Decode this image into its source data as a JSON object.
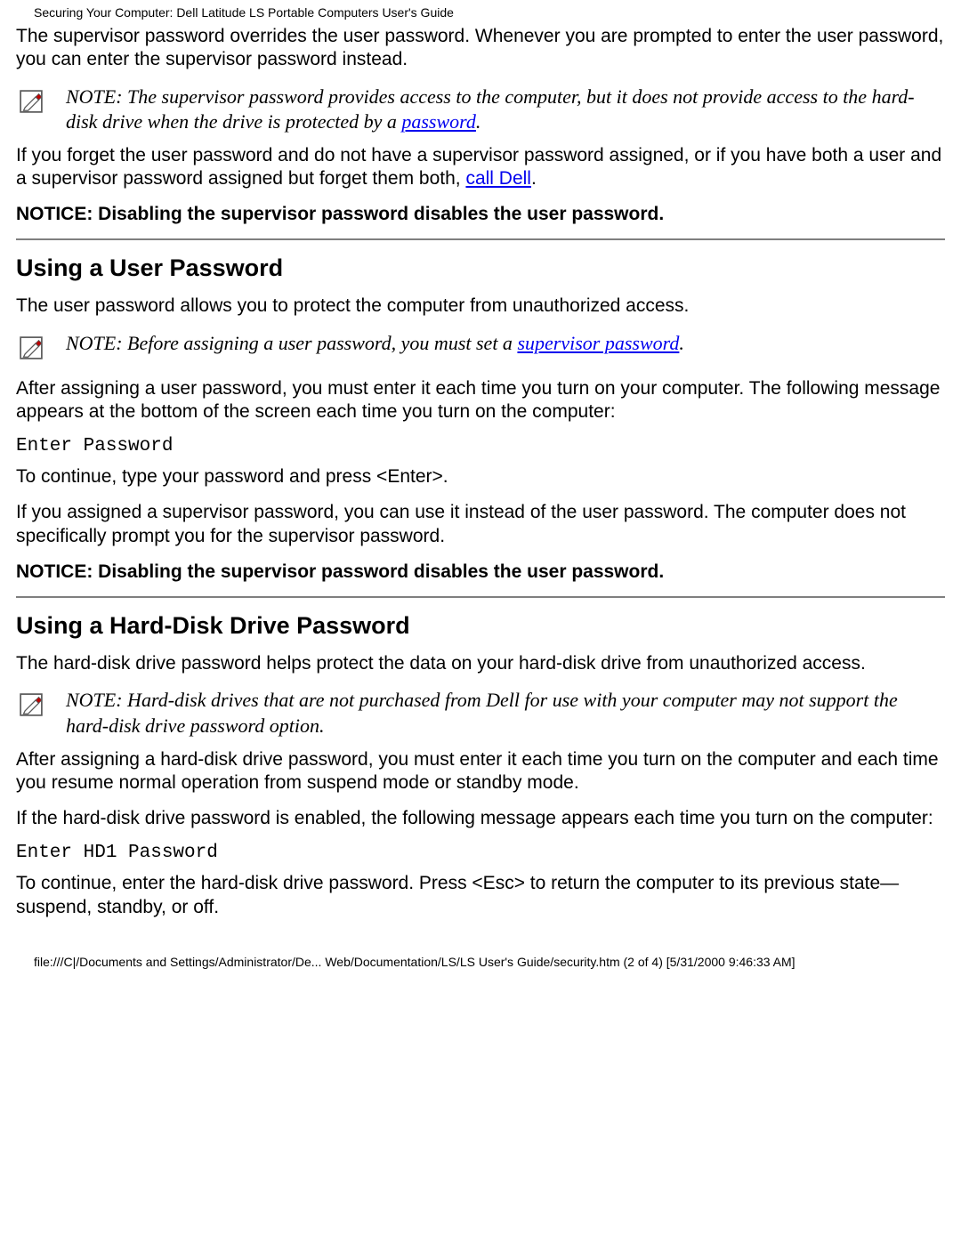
{
  "header_title": "Securing Your Computer: Dell Latitude LS Portable Computers User's Guide",
  "intro_paragraph": "The supervisor password overrides the user password. Whenever you are prompted to enter the user password, you can enter the supervisor password instead.",
  "note1": {
    "prefix": "NOTE: The supervisor password provides access to the computer, but it does not provide access to the hard-disk drive when the drive is protected by a ",
    "link": "password",
    "suffix": "."
  },
  "forgot_paragraph": {
    "prefix": "If you forget the user password and do not have a supervisor password assigned, or if you have both a user and a supervisor password assigned but forget them both, ",
    "link": "call Dell",
    "suffix": "."
  },
  "notice1": "NOTICE: Disabling the supervisor password disables the user password.",
  "section_user": {
    "heading": "Using a User Password",
    "p1": "The user password allows you to protect the computer from unauthorized access.",
    "note": {
      "prefix": "NOTE: Before assigning a user password, you must set a ",
      "link": "supervisor password",
      "suffix": "."
    },
    "p2": "After assigning a user password, you must enter it each time you turn on your computer. The following message appears at the bottom of the screen each time you turn on the computer:",
    "code": "Enter Password",
    "p3": "To continue, type your password and press <Enter>.",
    "p4": "If you assigned a supervisor password, you can use it instead of the user password. The computer does not specifically prompt you for the supervisor password.",
    "notice": "NOTICE: Disabling the supervisor password disables the user password."
  },
  "section_hdd": {
    "heading": "Using a Hard-Disk Drive Password",
    "p1": "The hard-disk drive password helps protect the data on your hard-disk drive from unauthorized access.",
    "note": "NOTE: Hard-disk drives that are not purchased from Dell for use with your computer may not support the hard-disk drive password option.",
    "p2": "After assigning a hard-disk drive password, you must enter it each time you turn on the computer and each time you resume normal operation from suspend mode or standby mode.",
    "p3": "If the hard-disk drive password is enabled, the following message appears each time you turn on the computer:",
    "code": "Enter HD1 Password",
    "p4": "To continue, enter the hard-disk drive password. Press <Esc> to return the computer to its previous state—suspend, standby, or off."
  },
  "footer": "file:///C|/Documents and Settings/Administrator/De... Web/Documentation/LS/LS User's Guide/security.htm (2 of 4) [5/31/2000 9:46:33 AM]"
}
